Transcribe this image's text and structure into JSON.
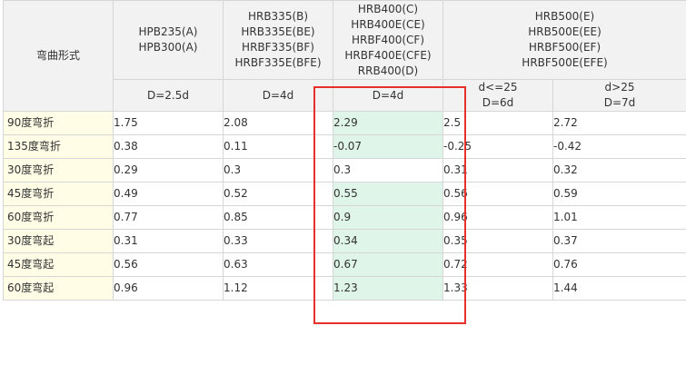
{
  "header": {
    "row_label": "弯曲形式",
    "groups": [
      {
        "lines": [
          "HPB235(A)",
          "HPB300(A)"
        ]
      },
      {
        "lines": [
          "HRB335(B)",
          "HRB335E(BE)",
          "HRBF335(BF)",
          "HRBF335E(BFE)"
        ]
      },
      {
        "lines": [
          "HRB400(C)",
          "HRB400E(CE)",
          "HRBF400(CF)",
          "HRBF400E(CFE)",
          "RRB400(D)"
        ]
      },
      {
        "lines": [
          "HRB500(E)",
          "HRB500E(EE)",
          "HRBF500(EF)",
          "HRBF500E(EFE)"
        ]
      }
    ],
    "sub": [
      {
        "lines": [
          "D=2.5d"
        ]
      },
      {
        "lines": [
          "D=4d"
        ]
      },
      {
        "lines": [
          "D=4d"
        ]
      },
      {
        "lines": [
          "d<=25",
          "D=6d"
        ]
      },
      {
        "lines": [
          "d>25",
          "D=7d"
        ]
      }
    ]
  },
  "rows": [
    {
      "label": "90度弯折",
      "values": [
        "1.75",
        "2.08",
        "2.29",
        "2.5",
        "2.72"
      ],
      "hl": true
    },
    {
      "label": "135度弯折",
      "values": [
        "0.38",
        "0.11",
        "-0.07",
        "-0.25",
        "-0.42"
      ],
      "hl": true
    },
    {
      "label": "30度弯折",
      "values": [
        "0.29",
        "0.3",
        "0.3",
        "0.31",
        "0.32"
      ],
      "hl": false
    },
    {
      "label": "45度弯折",
      "values": [
        "0.49",
        "0.52",
        "0.55",
        "0.56",
        "0.59"
      ],
      "hl": true
    },
    {
      "label": "60度弯折",
      "values": [
        "0.77",
        "0.85",
        "0.9",
        "0.96",
        "1.01"
      ],
      "hl": true
    },
    {
      "label": "30度弯起",
      "values": [
        "0.31",
        "0.33",
        "0.34",
        "0.35",
        "0.37"
      ],
      "hl": true
    },
    {
      "label": "45度弯起",
      "values": [
        "0.56",
        "0.63",
        "0.67",
        "0.72",
        "0.76"
      ],
      "hl": true
    },
    {
      "label": "60度弯起",
      "values": [
        "0.96",
        "1.12",
        "1.23",
        "1.33",
        "1.44"
      ],
      "hl": true
    }
  ],
  "colors": {
    "highlight": "#dff5ea",
    "row_label_bg": "#fffde6",
    "header_bg": "#f2f2f2",
    "annotation_border": "#e8302a"
  }
}
